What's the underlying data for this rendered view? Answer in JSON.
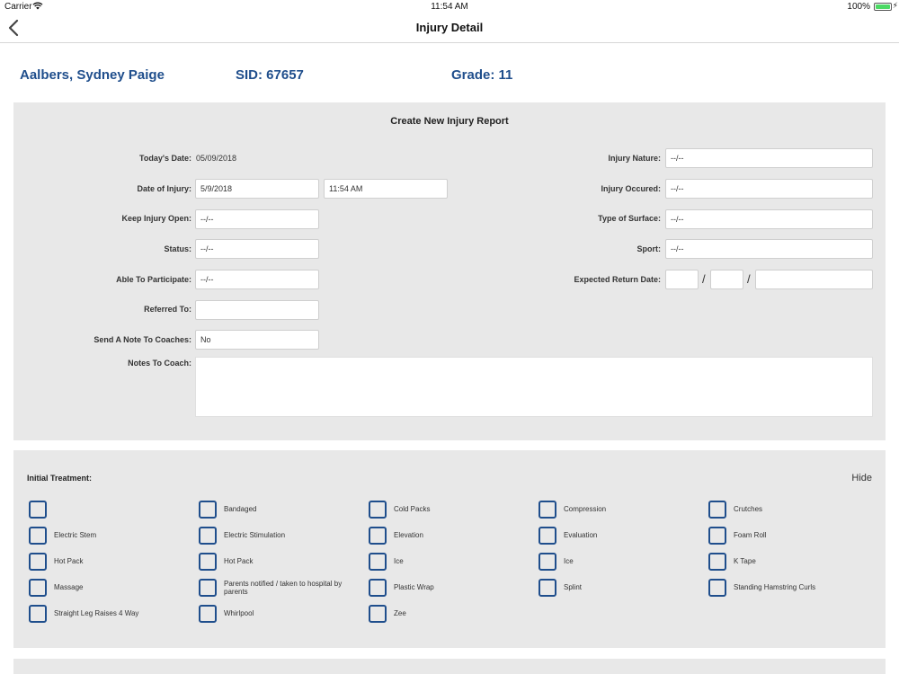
{
  "status_bar": {
    "carrier": "Carrier",
    "time": "11:54 AM",
    "battery": "100%"
  },
  "nav": {
    "title": "Injury Detail"
  },
  "student": {
    "name": "Aalbers, Sydney Paige",
    "sid": "SID: 67657",
    "grade": "Grade: 11"
  },
  "form": {
    "title": "Create New Injury Report",
    "todays_date_label": "Today's Date:",
    "todays_date_value": "05/09/2018",
    "date_of_injury_label": "Date of Injury:",
    "date_of_injury_value": "5/9/2018",
    "time_of_injury_value": "11:54 AM",
    "keep_open_label": "Keep Injury Open:",
    "keep_open_value": "--/--",
    "status_label": "Status:",
    "status_value": "--/--",
    "able_label": "Able To Participate:",
    "able_value": "--/--",
    "referred_label": "Referred To:",
    "referred_value": "",
    "send_note_label": "Send A Note To Coaches:",
    "send_note_value": "No",
    "notes_label": "Notes To Coach:",
    "notes_value": "",
    "nature_label": "Injury Nature:",
    "nature_value": "--/--",
    "occured_label": "Injury Occured:",
    "occured_value": "--/--",
    "surface_label": "Type of Surface:",
    "surface_value": "--/--",
    "sport_label": "Sport:",
    "sport_value": "--/--",
    "return_label": "Expected Return Date:",
    "return_month": "",
    "return_day": "",
    "return_year": "",
    "slash": "/"
  },
  "treatment": {
    "label": "Initial Treatment:",
    "hide": "Hide",
    "items": [
      "",
      "Bandaged",
      "Cold Packs",
      "Compression",
      "Crutches",
      "Electric Stem",
      "Electric Stimulation",
      "Elevation",
      "Evaluation",
      "Foam Roll",
      "Hot Pack",
      "Hot Pack",
      "Ice",
      "Ice",
      "K Tape",
      "Massage",
      "Parents notified / taken to hospital by parents",
      "Plastic Wrap",
      "Splint",
      "Standing Hamstring Curls",
      "Straight Leg Raises 4 Way",
      "Whirlpool",
      "Zee"
    ]
  },
  "colors": {
    "accent": "#1f4e8c",
    "panel": "#e8e8e8",
    "battery": "#4cd964"
  }
}
